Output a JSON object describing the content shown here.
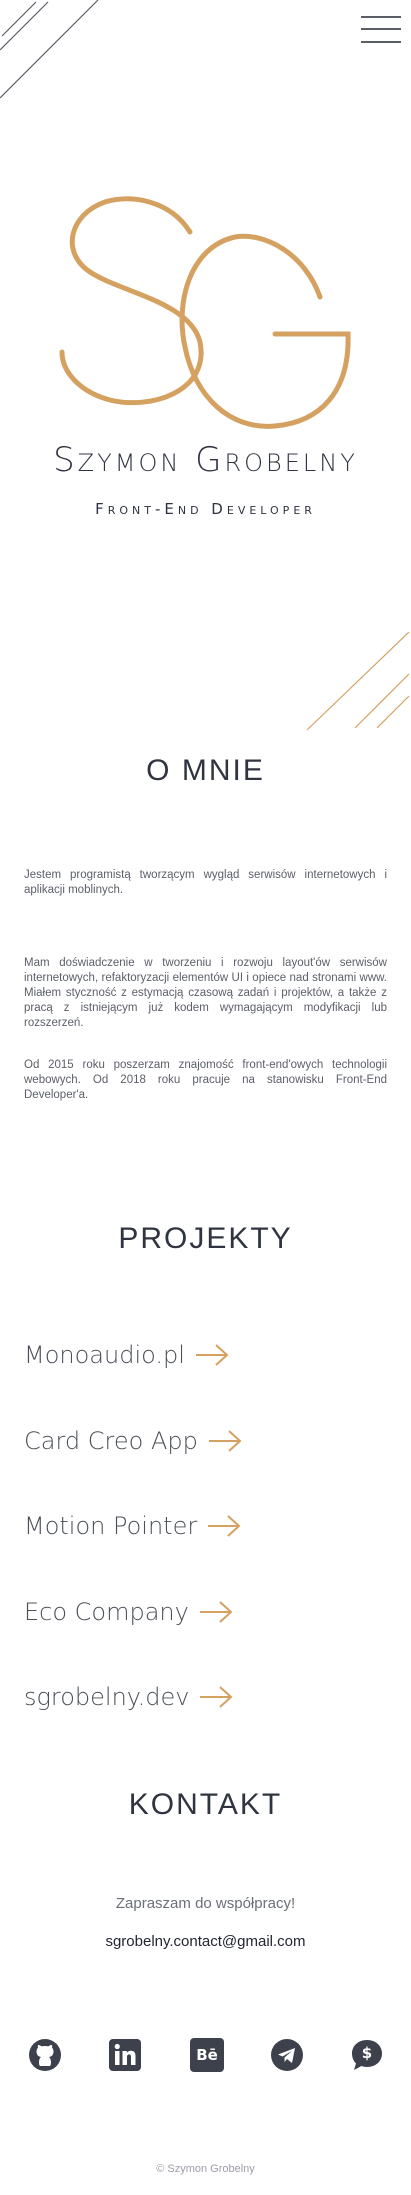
{
  "colors": {
    "accent": "#d4a160",
    "text": "#2f3440",
    "muted": "#5c6069"
  },
  "header": {
    "menu_icon": "hamburger-icon"
  },
  "hero": {
    "monogram": "SG",
    "name": "Szymon Grobelny",
    "role": "Front-End Developer"
  },
  "about": {
    "title": "O MNIE",
    "paragraphs": [
      "Jestem programistą tworzącym wygląd serwisów internetowych i aplikacji moblinych.",
      "Mam doświadczenie w tworzeniu i rozwoju layout'ów serwisów internetowych, refaktoryzacji elementów UI i opiece nad stronami www. Miałem styczność z estymacją czasową zadań i projektów, a także z pracą z istniejącym już kodem wymagającym modyfikacji lub rozszerzeń.",
      "Od 2015 roku poszerzam znajomość front-end'owych technologii webowych. Od 2018 roku pracuje na stanowisku Front-End Developer'a."
    ]
  },
  "projects": {
    "title": "PROJEKTY",
    "items": [
      {
        "label": "Monoaudio.pl"
      },
      {
        "label": "Card Creo App"
      },
      {
        "label": "Motion Pointer"
      },
      {
        "label": "Eco Company"
      },
      {
        "label": "sgrobelny.dev"
      }
    ],
    "arrow_icon": "arrow-right-icon"
  },
  "contact": {
    "title": "KONTAKT",
    "invite": "Zapraszam do współpracy!",
    "email": "sgrobelny.contact@gmail.com"
  },
  "social": [
    {
      "icon": "github-icon"
    },
    {
      "icon": "linkedin-icon"
    },
    {
      "icon": "behance-icon",
      "glyph": "Bē"
    },
    {
      "icon": "telegram-icon"
    },
    {
      "icon": "payment-chat-icon",
      "glyph": "$"
    }
  ],
  "footer": {
    "copyright": "© Szymon Grobelny"
  }
}
